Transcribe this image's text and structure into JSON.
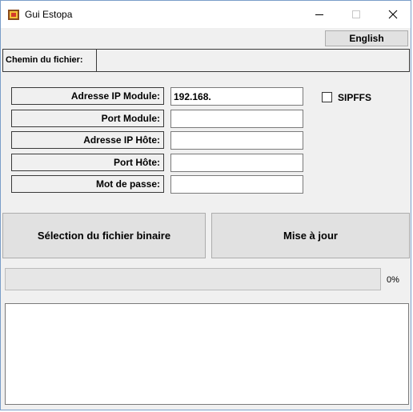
{
  "window": {
    "title": "Gui Estopa"
  },
  "icons": {
    "app": "app-icon",
    "minimize": "minimize-icon",
    "maximize": "maximize-icon",
    "close": "close-icon"
  },
  "toolbar": {
    "language_button": "English"
  },
  "file_path": {
    "label": "Chemin du fichier:",
    "value": ""
  },
  "fields": [
    {
      "label": "Adresse IP Module:",
      "value": "192.168."
    },
    {
      "label": "Port Module:",
      "value": ""
    },
    {
      "label": "Adresse IP Hôte:",
      "value": ""
    },
    {
      "label": "Port Hôte:",
      "value": ""
    },
    {
      "label": "Mot de passe:",
      "value": ""
    }
  ],
  "sipffs": {
    "label": "SIPFFS",
    "checked": false
  },
  "actions": {
    "select_binary": "Sélection du fichier binaire",
    "update": "Mise à jour"
  },
  "progress": {
    "value": 0,
    "text": "0%"
  },
  "log": {
    "text": ""
  },
  "colors": {
    "title_bar": "#ffffff",
    "window_bg": "#f0f0f0",
    "button_bg": "#e1e1e1",
    "window_border": "#7a9ec9"
  }
}
